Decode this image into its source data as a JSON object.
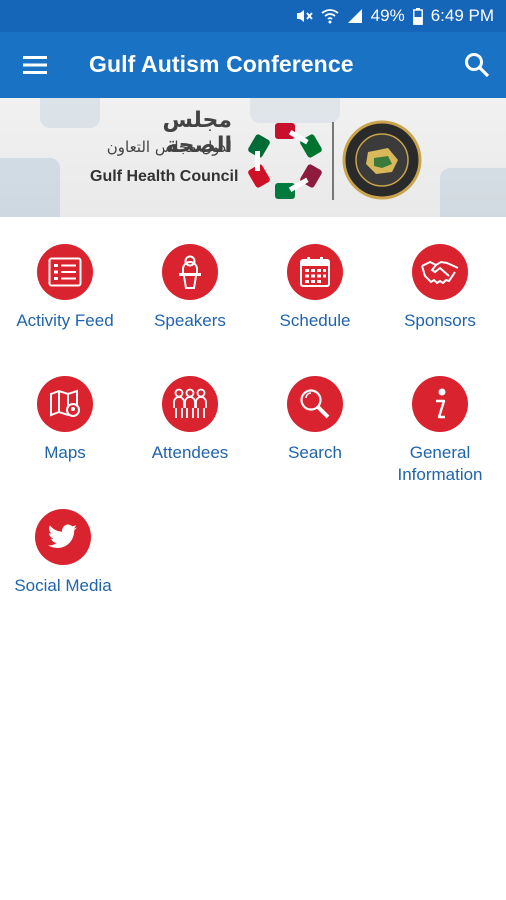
{
  "status_bar": {
    "battery": "49%",
    "time": "6:49 PM"
  },
  "app_bar": {
    "title": "Gulf Autism Conference"
  },
  "banner": {
    "arabic_line1": "مجلس الصحة",
    "arabic_line2": "لدول مجلس التعاون",
    "english": "Gulf Health Council"
  },
  "tiles": [
    {
      "label": "Activity Feed",
      "icon": "activity-feed-icon"
    },
    {
      "label": "Speakers",
      "icon": "speaker-icon"
    },
    {
      "label": "Schedule",
      "icon": "calendar-icon"
    },
    {
      "label": "Sponsors",
      "icon": "handshake-icon"
    },
    {
      "label": "Maps",
      "icon": "map-icon"
    },
    {
      "label": "Attendees",
      "icon": "attendees-icon"
    },
    {
      "label": "Search",
      "icon": "search-icon"
    },
    {
      "label": "General\nInformation",
      "icon": "info-icon"
    },
    {
      "label": "Social Media",
      "icon": "twitter-icon"
    }
  ],
  "colors": {
    "app_bar": "#1a72c4",
    "status_bar": "#1565b9",
    "icon_circle": "#d9232e",
    "label": "#1f64ac"
  }
}
